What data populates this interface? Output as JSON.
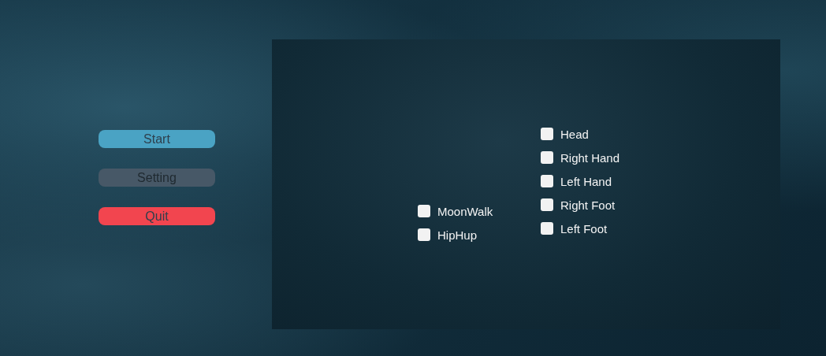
{
  "menu_buttons": [
    {
      "label": "Start",
      "color": "#4aa3c4",
      "disabled": false
    },
    {
      "label": "Setting",
      "color": "#3d5a72",
      "disabled": true
    },
    {
      "label": "Quit",
      "color": "#f2454f",
      "disabled": false
    }
  ],
  "dance_options": [
    {
      "label": "MoonWalk",
      "checked": false
    },
    {
      "label": "HipHup",
      "checked": false
    }
  ],
  "body_parts": [
    {
      "label": "Head",
      "checked": false
    },
    {
      "label": "Right Hand",
      "checked": false
    },
    {
      "label": "Left Hand",
      "checked": false
    },
    {
      "label": "Right Foot",
      "checked": false
    },
    {
      "label": "Left Foot",
      "checked": false
    }
  ]
}
